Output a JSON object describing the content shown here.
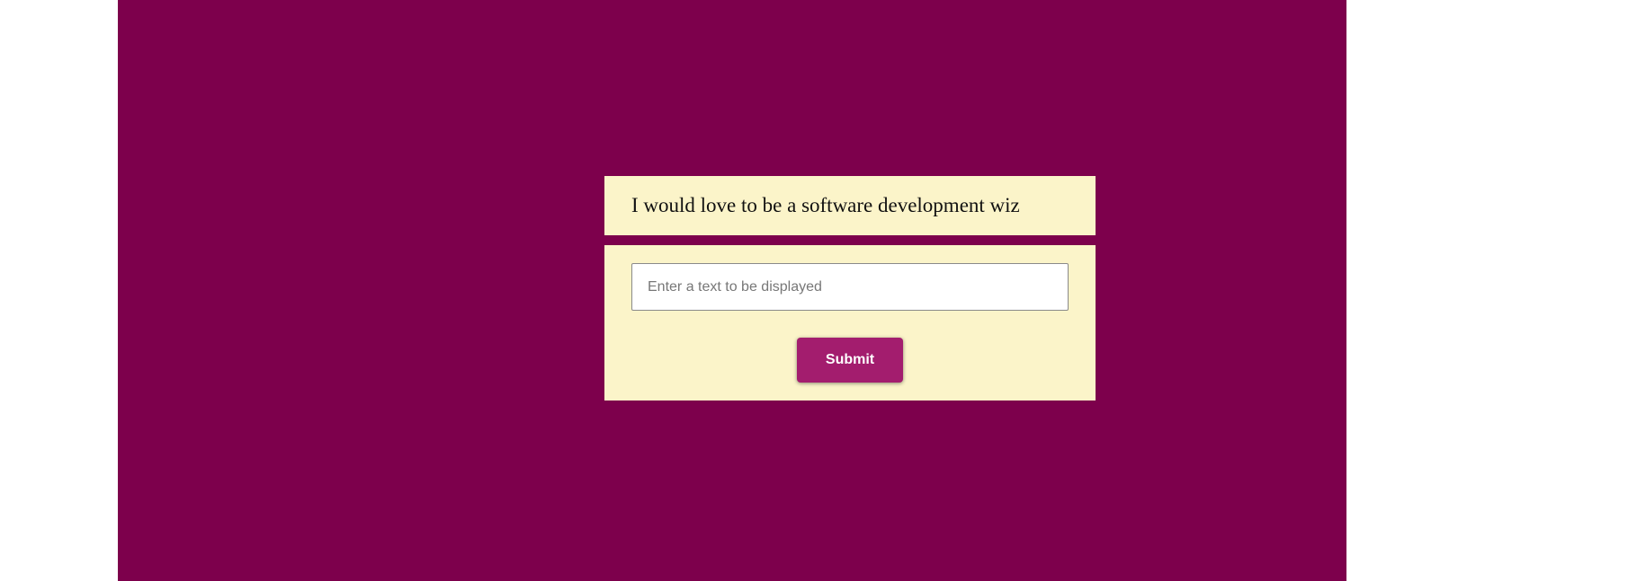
{
  "theme": {
    "background": "#7d004c",
    "card": "#fbf4c9",
    "button": "#a31d6e",
    "button_text": "#ffffff"
  },
  "display": {
    "text": "I would love to be a software development wiz"
  },
  "form": {
    "input": {
      "value": "",
      "placeholder": "Enter a text to be displayed"
    },
    "submit_label": "Submit"
  }
}
